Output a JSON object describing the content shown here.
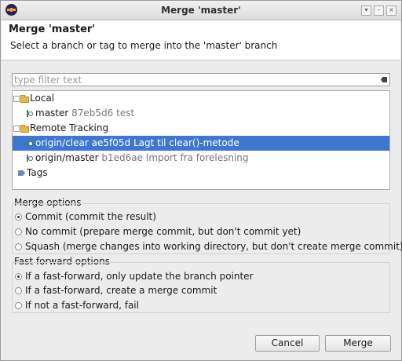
{
  "window": {
    "title": "Merge 'master'"
  },
  "header": {
    "title": "Merge 'master'",
    "description": "Select a branch or tag to merge into the 'master' branch"
  },
  "filter": {
    "placeholder": "type filter text"
  },
  "tree": {
    "local": {
      "label": "Local",
      "items": [
        {
          "name": "master",
          "detail": "87eb5d6 test"
        }
      ]
    },
    "remote": {
      "label": "Remote Tracking",
      "items": [
        {
          "name": "origin/clear",
          "detail": "ae5f05d Lagt til clear()-metode",
          "selected": true
        },
        {
          "name": "origin/master",
          "detail": "b1ed6ae Import fra forelesning",
          "selected": false
        }
      ]
    },
    "tags": {
      "label": "Tags"
    }
  },
  "merge_options": {
    "label": "Merge options",
    "options": [
      {
        "text": "Commit (commit the result)",
        "checked": true
      },
      {
        "text": "No commit (prepare merge commit, but don't commit yet)",
        "checked": false
      },
      {
        "text": "Squash (merge changes into working directory, but don't create merge commit)",
        "checked": false
      }
    ]
  },
  "ff_options": {
    "label": "Fast forward options",
    "options": [
      {
        "text": "If a fast-forward, only update the branch pointer",
        "checked": true
      },
      {
        "text": "If a fast-forward, create a merge commit",
        "checked": false
      },
      {
        "text": "If not a fast-forward, fail",
        "checked": false
      }
    ]
  },
  "buttons": {
    "cancel": "Cancel",
    "merge": "Merge"
  }
}
